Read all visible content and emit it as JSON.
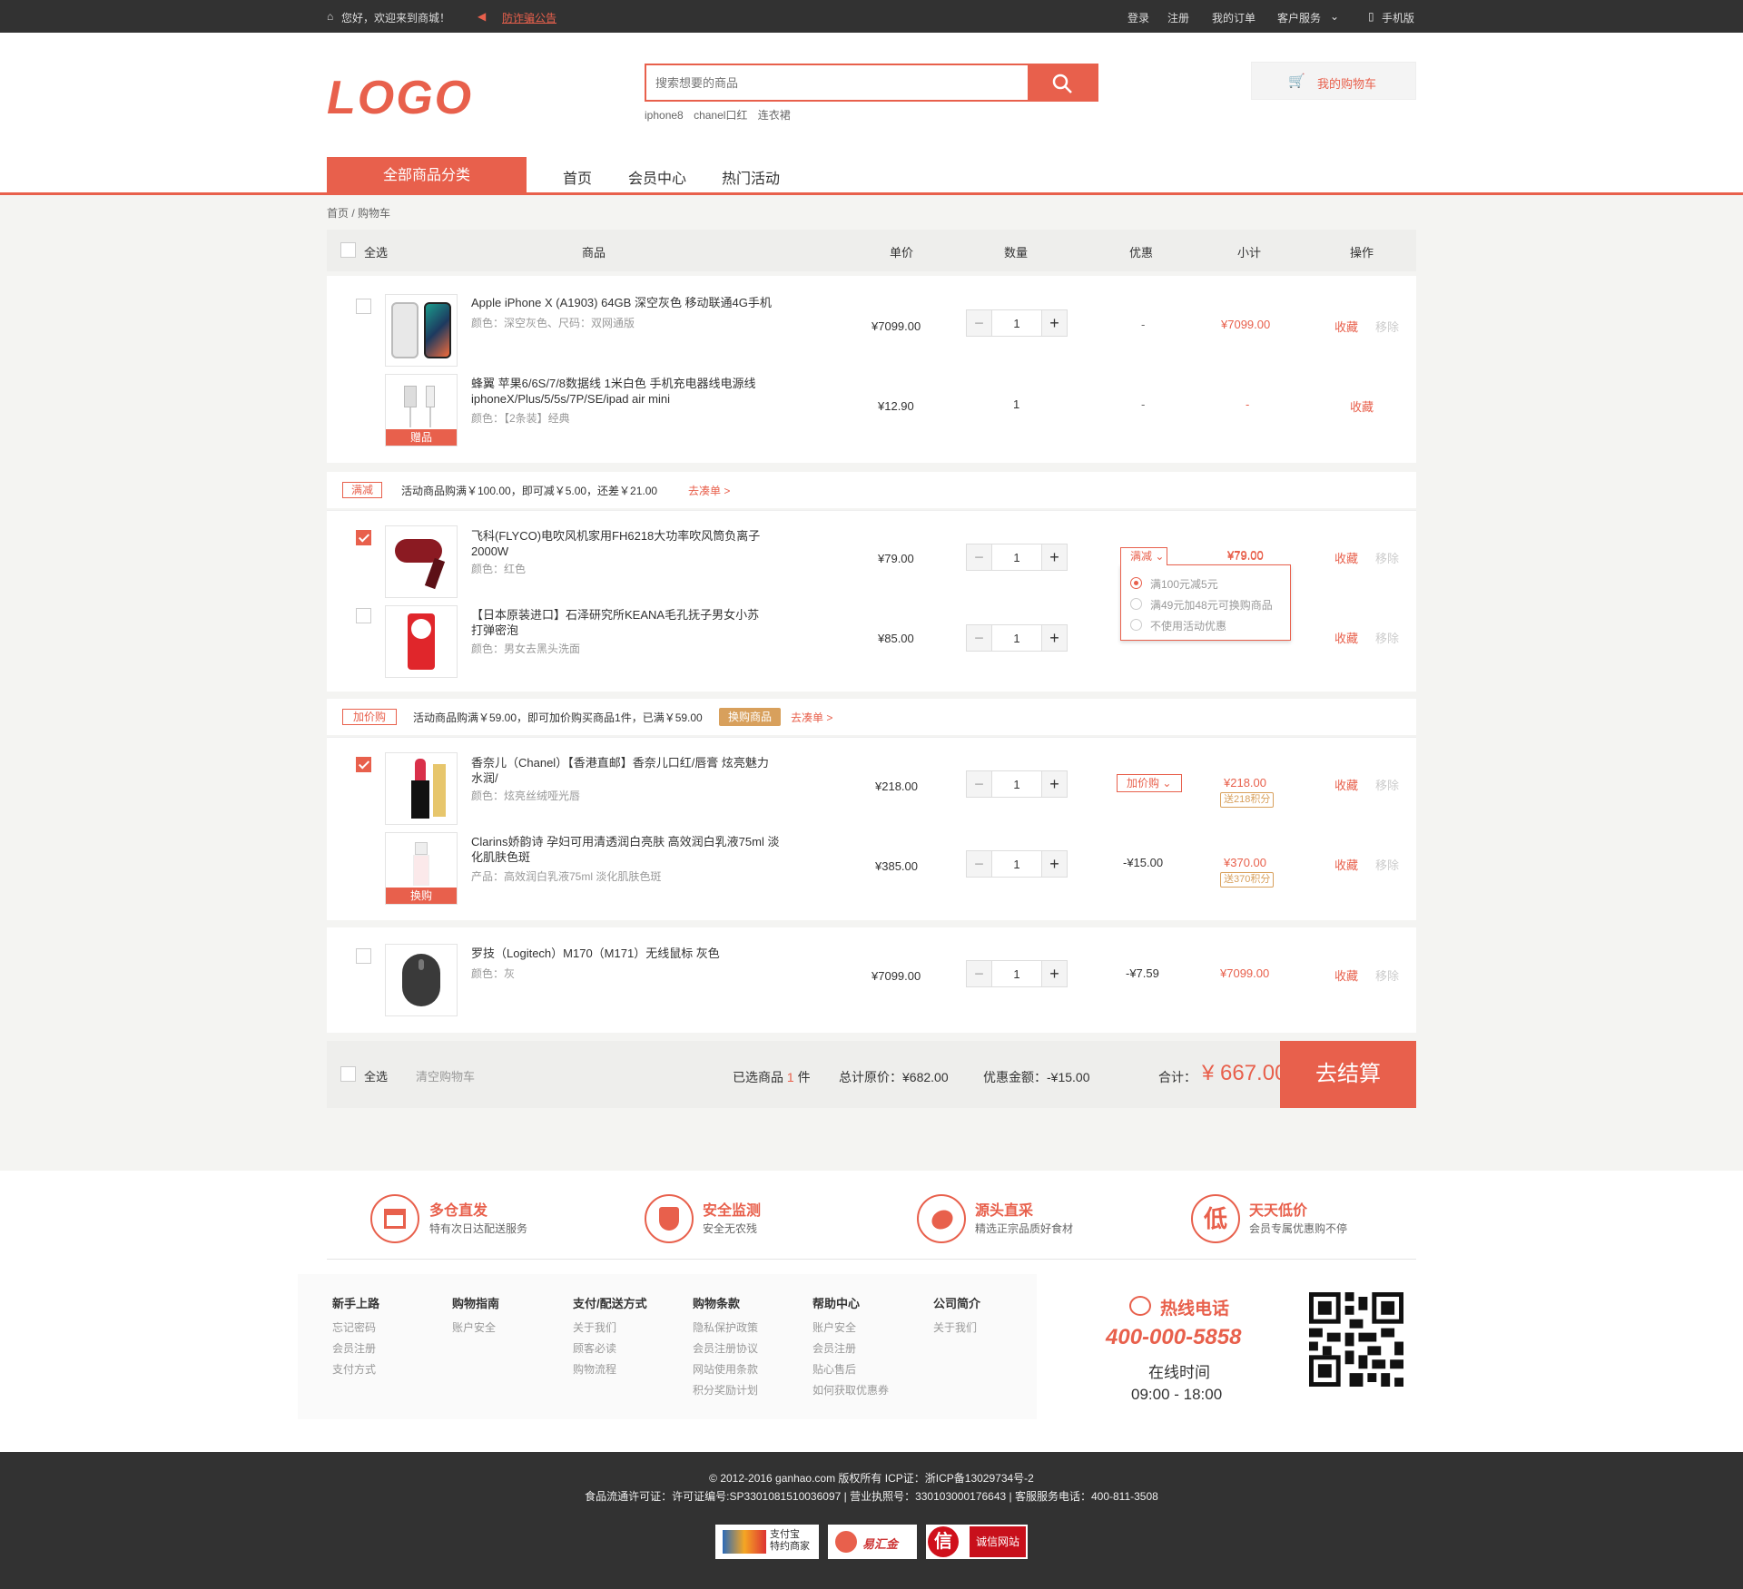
{
  "topbar": {
    "welcome": "您好，欢迎来到商城！",
    "notice": "防诈骗公告",
    "login": "登录",
    "register": "注册",
    "my_orders": "我的订单",
    "customer_service": "客户服务",
    "mobile": "手机版"
  },
  "header": {
    "logo": "LOGO",
    "search_placeholder": "搜索想要的商品",
    "hot_searches": [
      "iphone8",
      "chanel口红",
      "连衣裙"
    ],
    "cart_label": "我的购物车"
  },
  "nav": {
    "all_categories": "全部商品分类",
    "items": [
      "首页",
      "会员中心",
      "热门活动"
    ]
  },
  "breadcrumb": "首页 / 购物车",
  "table_header": {
    "select_all": "全选",
    "product": "商品",
    "unit_price": "单价",
    "quantity": "数量",
    "discount": "优惠",
    "subtotal": "小计",
    "action": "操作"
  },
  "groups": [
    {
      "items": [
        {
          "name": "Apple iPhone X (A1903) 64GB 深空灰色 移动联通4G手机",
          "attr": "颜色：深空灰色、尺码：双网通版",
          "price": "¥7099.00",
          "qty": "1",
          "discount": "-",
          "subtotal": "¥7099.00",
          "op1": "收藏",
          "op2": "移除",
          "checked": false
        },
        {
          "name": "蜂翼 苹果6/6S/7/8数据线 1米白色 手机充电器线电源线 iphoneX/Plus/5/5s/7P/SE/ipad air mini",
          "attr": "颜色：【2条装】经典",
          "price": "¥12.90",
          "qty": "1",
          "discount": "-",
          "subtotal": "-",
          "op1": "收藏",
          "tag": "赠品"
        }
      ]
    },
    {
      "promo": {
        "label": "满减",
        "text": "活动商品购满￥100.00，即可减￥5.00，还差￥21.00",
        "link": "去凑单 >"
      },
      "items": [
        {
          "name": "飞科(FLYCO)电吹风机家用FH6218大功率吹风筒负离子2000W",
          "attr": "颜色：红色",
          "price": "¥79.00",
          "qty": "1",
          "subtotal": "¥79.00",
          "op1": "收藏",
          "op2": "移除",
          "checked": true
        },
        {
          "name": "【日本原装进口】石泽研究所KEANA毛孔抚子男女小苏打弹密泡",
          "attr": "颜色：男女去黑头洗面",
          "price": "¥85.00",
          "qty": "1",
          "op1": "收藏",
          "op2": "移除",
          "checked": false
        }
      ],
      "dropdown": {
        "label": "满减",
        "options": [
          "满100元减5元",
          "满49元加48元可换购商品",
          "不使用活动优惠"
        ]
      }
    },
    {
      "promo": {
        "label": "加价购",
        "text": "活动商品购满￥59.00，即可加价购买商品1件，已满￥59.00",
        "badge": "换购商品",
        "link": "去凑单 >"
      },
      "items": [
        {
          "name": "香奈儿（Chanel）【香港直邮】香奈儿口红/唇膏 炫亮魅力水润/",
          "attr": "颜色：炫亮丝绒哑光唇",
          "price": "¥218.00",
          "qty": "1",
          "discount_select": "加价购",
          "subtotal": "¥218.00",
          "points": "送218积分",
          "op1": "收藏",
          "op2": "移除",
          "checked": true
        },
        {
          "name": "Clarins娇韵诗 孕妇可用清透润白亮肤 高效润白乳液75ml 淡化肌肤色斑",
          "attr": "产品：高效润白乳液75ml 淡化肌肤色斑",
          "price": "¥385.00",
          "qty": "1",
          "discount": "-¥15.00",
          "subtotal": "¥370.00",
          "points": "送370积分",
          "op1": "收藏",
          "op2": "移除",
          "tag": "换购"
        }
      ]
    },
    {
      "items": [
        {
          "name": "罗技（Logitech）M170（M171）无线鼠标 灰色",
          "attr": "颜色：灰",
          "price": "¥7099.00",
          "qty": "1",
          "discount": "-¥7.59",
          "subtotal": "¥7099.00",
          "op1": "收藏",
          "op2": "移除",
          "checked": false
        }
      ]
    }
  ],
  "summary": {
    "select_all": "全选",
    "clear": "清空购物车",
    "selected_prefix": "已选商品",
    "selected_count": "1",
    "selected_suffix": "件",
    "original_total": "总计原价：¥682.00",
    "discount_total": "优惠金额：-¥15.00",
    "total_label": "合计：",
    "total": "¥ 667.00",
    "checkout": "去结算"
  },
  "features": [
    {
      "title": "多仓直发",
      "desc": "特有次日达配送服务",
      "icon": "warehouse-icon"
    },
    {
      "title": "安全监测",
      "desc": "安全无农残",
      "icon": "shield-icon"
    },
    {
      "title": "源头直采",
      "desc": "精选正宗品质好食材",
      "icon": "source-icon"
    },
    {
      "title": "天天低价",
      "desc": "会员专属优惠购不停",
      "icon": "low-price-icon"
    }
  ],
  "footer_links": [
    {
      "title": "新手上路",
      "links": [
        "忘记密码",
        "会员注册",
        "支付方式"
      ]
    },
    {
      "title": "购物指南",
      "links": [
        "账户安全"
      ]
    },
    {
      "title": "支付/配送方式",
      "links": [
        "关于我们",
        "顾客必读",
        "购物流程"
      ]
    },
    {
      "title": "购物条款",
      "links": [
        "隐私保护政策",
        "会员注册协议",
        "网站使用条款",
        "积分奖励计划"
      ]
    },
    {
      "title": "帮助中心",
      "links": [
        "账户安全",
        "会员注册",
        "贴心售后",
        "如何获取优惠券"
      ]
    },
    {
      "title": "公司简介",
      "links": [
        "关于我们"
      ]
    }
  ],
  "hotline": {
    "label": "热线电话",
    "phone": "400-000-5858",
    "hours_label": "在线时间",
    "hours": "09:00 - 18:00"
  },
  "copyright": {
    "line1": "© 2012-2016 ganhao.com 版权所有 ICP证：浙ICP备13029734号-2",
    "line2": "食品流通许可证：许可证编号:SP3301081510036097 | 营业执照号：330103000176643 | 客服服务电话：400-811-3508"
  },
  "badges": {
    "alipay_1": "支付宝",
    "alipay_2": "特约商家",
    "yihuijin": "易汇金",
    "chengxin_glyph": "信",
    "chengxin": "诚信网站"
  },
  "colors": {
    "accent": "#e8604c",
    "dark": "#323232",
    "gold": "#d8a05c"
  }
}
